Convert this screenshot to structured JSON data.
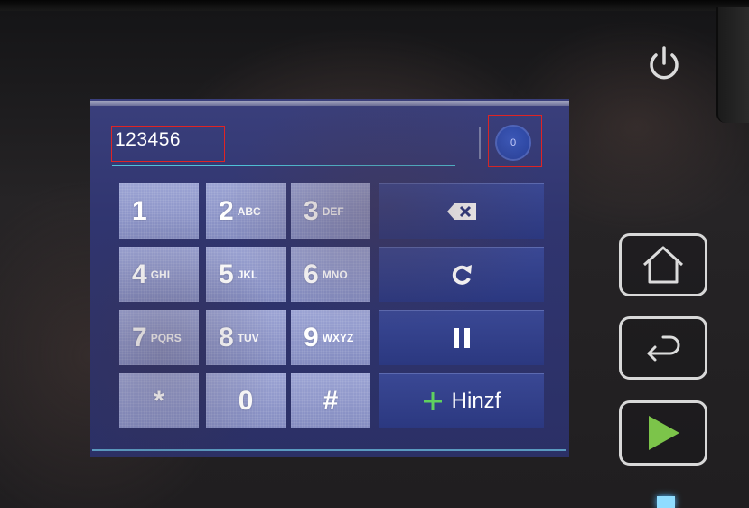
{
  "screen": {
    "number_input": {
      "value": "123456"
    },
    "counter_button": {
      "label": "0"
    },
    "keypad": {
      "keys": [
        {
          "digit": "1"
        },
        {
          "digit": "2",
          "letters": "ABC"
        },
        {
          "digit": "3",
          "letters": "DEF"
        },
        {
          "digit": "4",
          "letters": "GHI"
        },
        {
          "digit": "5",
          "letters": "JKL"
        },
        {
          "digit": "6",
          "letters": "MNO"
        },
        {
          "digit": "7",
          "letters": "PQRS"
        },
        {
          "digit": "8",
          "letters": "TUV"
        },
        {
          "digit": "9",
          "letters": "WXYZ"
        },
        {
          "digit": "*"
        },
        {
          "digit": "0"
        },
        {
          "digit": "#"
        }
      ]
    },
    "function_keys": {
      "backspace": {
        "icon": "backspace-icon"
      },
      "redial": {
        "icon": "redial-icon"
      },
      "pause": {
        "icon": "pause-icon"
      },
      "add": {
        "icon": "plus-icon",
        "label": "Hinzf"
      }
    }
  },
  "hardware_buttons": {
    "power": {
      "icon": "power-icon"
    },
    "home": {
      "icon": "home-icon"
    },
    "back": {
      "icon": "back-icon"
    },
    "start": {
      "icon": "start-icon"
    }
  },
  "colors": {
    "screen_background": "#30356f",
    "keypad_key": "#8d95c7",
    "function_key": "#2f3c86",
    "input_underline": "#4fc3d9",
    "plus_icon": "#5fd05f",
    "start_icon": "#7cc44a",
    "annotation_box": "#e02424",
    "status_led": "#8fdcff"
  }
}
